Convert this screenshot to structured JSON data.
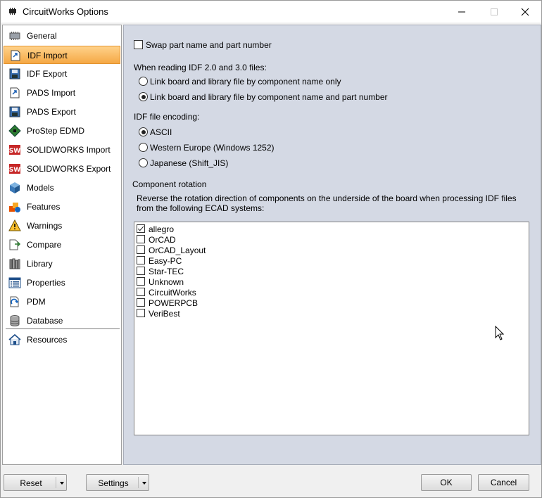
{
  "window": {
    "title": "CircuitWorks Options"
  },
  "sidebar": {
    "items": [
      {
        "label": "General",
        "icon": "general-chip-icon"
      },
      {
        "label": "IDF Import",
        "icon": "idf-import-icon"
      },
      {
        "label": "IDF Export",
        "icon": "idf-export-icon"
      },
      {
        "label": "PADS Import",
        "icon": "pads-import-icon"
      },
      {
        "label": "PADS Export",
        "icon": "pads-export-icon"
      },
      {
        "label": "ProStep EDMD",
        "icon": "prostep-board-icon"
      },
      {
        "label": "SOLIDWORKS Import",
        "icon": "solidworks-import-icon"
      },
      {
        "label": "SOLIDWORKS Export",
        "icon": "solidworks-export-icon"
      },
      {
        "label": "Models",
        "icon": "cube-icon"
      },
      {
        "label": "Features",
        "icon": "features-icon"
      },
      {
        "label": "Warnings",
        "icon": "warning-icon"
      },
      {
        "label": "Compare",
        "icon": "compare-icon"
      },
      {
        "label": "Library",
        "icon": "library-icon"
      },
      {
        "label": "Properties",
        "icon": "properties-icon"
      },
      {
        "label": "PDM",
        "icon": "pdm-icon"
      },
      {
        "label": "Database",
        "icon": "database-icon"
      },
      {
        "label": "Resources",
        "icon": "home-icon"
      }
    ],
    "selected_index": 1
  },
  "content": {
    "swap_label": "Swap part name and part number",
    "swap_checked": false,
    "reading_heading": "When reading IDF 2.0 and 3.0 files:",
    "link_options": [
      {
        "label": "Link board and library file by component name only",
        "checked": false
      },
      {
        "label": "Link board and library file by component name and part number",
        "checked": true
      }
    ],
    "encoding_heading": "IDF file encoding:",
    "encoding_options": [
      {
        "label": "ASCII",
        "checked": true
      },
      {
        "label": "Western Europe (Windows 1252)",
        "checked": false
      },
      {
        "label": "Japanese (Shift_JIS)",
        "checked": false
      }
    ],
    "rotation_heading": "Component rotation",
    "rotation_description": "Reverse the rotation direction of components on the underside of the board when processing IDF files from the following ECAD systems:",
    "ecad_systems": [
      {
        "label": "allegro",
        "checked": true
      },
      {
        "label": "OrCAD",
        "checked": false
      },
      {
        "label": "OrCAD_Layout",
        "checked": false
      },
      {
        "label": "Easy-PC",
        "checked": false
      },
      {
        "label": "Star-TEC",
        "checked": false
      },
      {
        "label": "Unknown",
        "checked": false
      },
      {
        "label": "CircuitWorks",
        "checked": false
      },
      {
        "label": "POWERPCB",
        "checked": false
      },
      {
        "label": "VeriBest",
        "checked": false
      }
    ]
  },
  "footer": {
    "reset_label": "Reset",
    "settings_label": "Settings",
    "ok_label": "OK",
    "cancel_label": "Cancel"
  },
  "colors": {
    "selected_item": "#f5a845",
    "content_background": "#d4d9e4"
  }
}
